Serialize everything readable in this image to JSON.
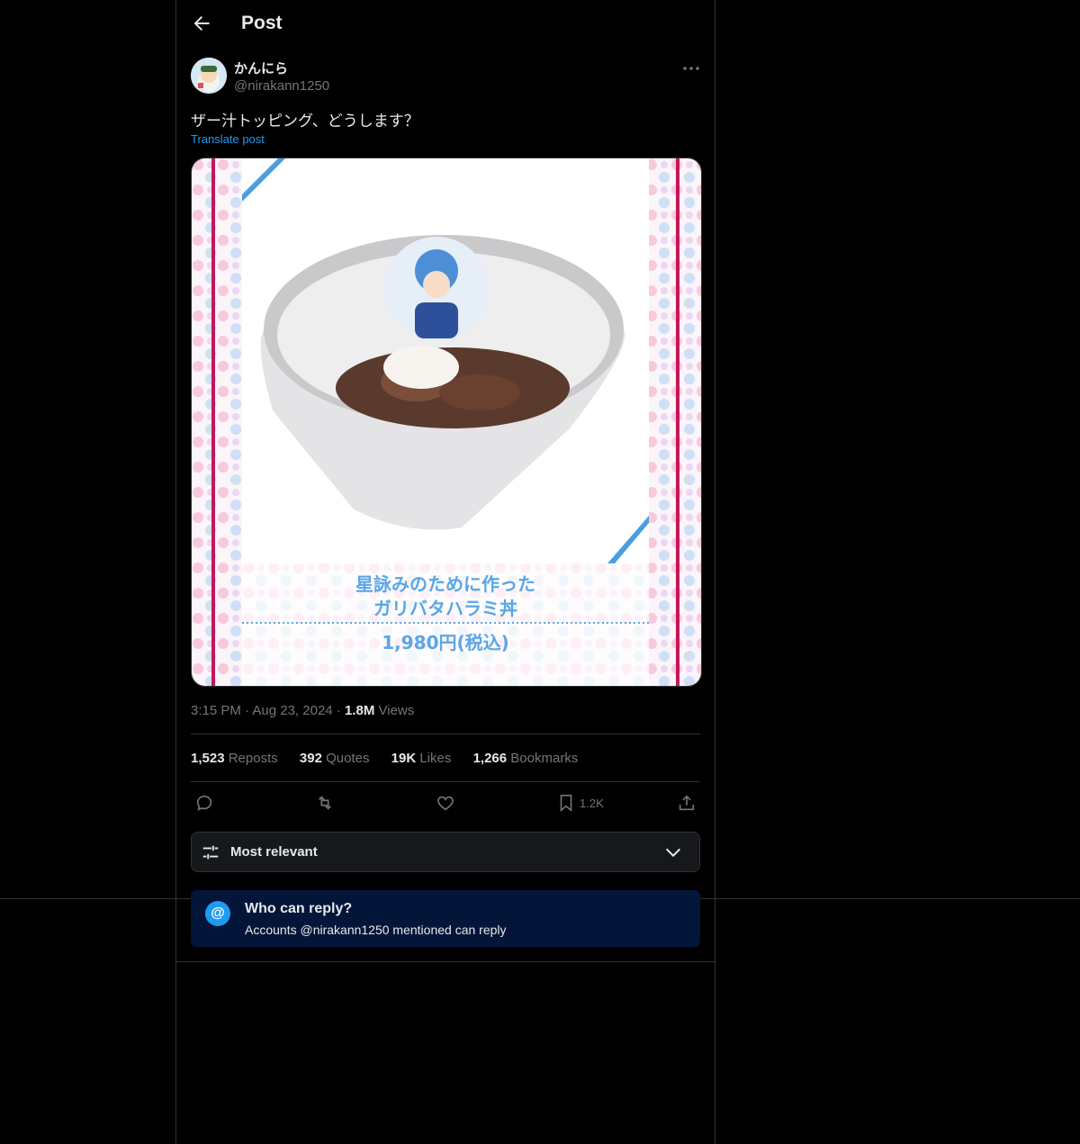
{
  "header": {
    "title": "Post",
    "back_icon": "arrow-left-icon"
  },
  "author": {
    "name": "かんにら",
    "handle": "@nirakann1250"
  },
  "post": {
    "text": "ザー汁トッピング、どうします？",
    "translate_label": "Translate post",
    "image": {
      "caption_line1": "星詠みのために作った",
      "caption_line2": "ガリバタハラミ丼",
      "price": "1,980円(税込)"
    }
  },
  "meta": {
    "time": "3:15 PM",
    "date": "Aug 23, 2024",
    "views_count": "1.8M",
    "views_label": "Views"
  },
  "stats": {
    "reposts_count": "1,523",
    "reposts_label": "Reposts",
    "quotes_count": "392",
    "quotes_label": "Quotes",
    "likes_count": "19K",
    "likes_label": "Likes",
    "bookmarks_count": "1,266",
    "bookmarks_label": "Bookmarks"
  },
  "actions": {
    "bookmark_count": "1.2K"
  },
  "sort": {
    "label": "Most relevant"
  },
  "reply_notice": {
    "title": "Who can reply?",
    "subtitle": "Accounts @nirakann1250 mentioned can reply",
    "icon": "@"
  },
  "colors": {
    "accent": "#1d9bf0",
    "notice_bg": "#031538",
    "border": "#2f3336",
    "muted": "#71767b"
  }
}
